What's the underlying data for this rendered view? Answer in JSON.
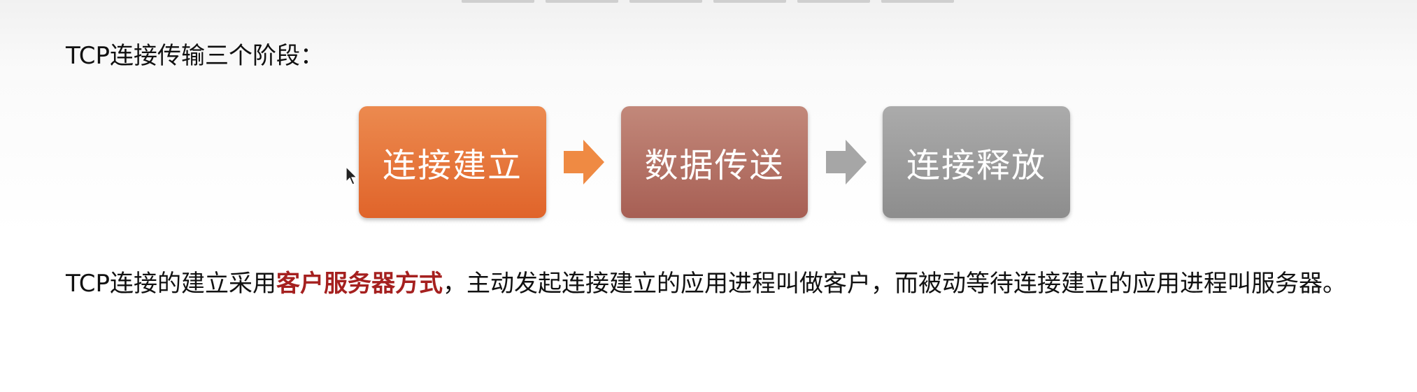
{
  "title": "TCP连接传输三个阶段：",
  "diagram": {
    "steps": [
      "连接建立",
      "数据传送",
      "连接释放"
    ],
    "colors": {
      "step1": "#e5733a",
      "step2": "#b5746a",
      "step3": "#9a9a9a",
      "arrow1": "#ef8a43",
      "arrow2": "#a6a6a6"
    }
  },
  "paragraph": {
    "part1": "TCP连接的建立采用",
    "highlight": "客户服务器方式",
    "part2": "，主动发起连接建立的应用进程叫做客户，而被动等待连接建立的应用进程叫服务器。",
    "highlight_color": "#a5201f"
  }
}
